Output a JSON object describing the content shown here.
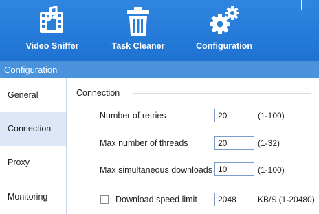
{
  "toolbar": {
    "video_sniffer": {
      "label": "Video Sniffer",
      "icon": "music-film-icon"
    },
    "task_cleaner": {
      "label": "Task Cleaner",
      "icon": "trash-icon"
    },
    "configuration": {
      "label": "Configuration",
      "icon": "gears-icon"
    }
  },
  "window": {
    "title": "Configuration"
  },
  "sidebar": {
    "items": [
      {
        "label": "General"
      },
      {
        "label": "Connection",
        "active": true
      },
      {
        "label": "Proxy"
      },
      {
        "label": "Monitoring"
      }
    ]
  },
  "connection": {
    "group_title": "Connection",
    "retries": {
      "label": "Number of retries",
      "value": "20",
      "range": "(1-100)"
    },
    "threads": {
      "label": "Max number of threads",
      "value": "20",
      "range": "(1-32)"
    },
    "downloads": {
      "label": "Max simultaneous downloads",
      "value": "10",
      "range": "(1-100)"
    },
    "speed_limit": {
      "label": "Download speed limit",
      "checked": false,
      "value": "2048",
      "range": "KB/S (1-20480)"
    }
  },
  "colors": {
    "toolbar": "#2a7fdb",
    "titlebar": "#4a92dc",
    "active_item": "#dde7f7",
    "input_border": "#7a9cc9"
  }
}
